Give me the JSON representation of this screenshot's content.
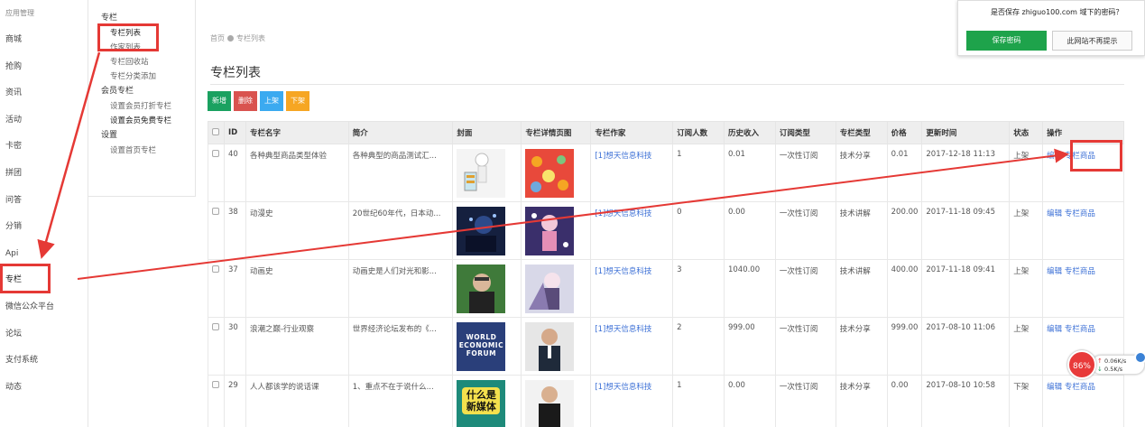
{
  "leftnav": {
    "header": "应用管理",
    "items": [
      "商城",
      "抢购",
      "资讯",
      "活动",
      "卡密",
      "拼团",
      "问答",
      "分销",
      "Api",
      "专栏",
      "微信公众平台",
      "论坛",
      "支付系统",
      "动态"
    ]
  },
  "subnav": {
    "group1": "专栏",
    "g1_items": [
      "专栏列表",
      "作家列表",
      "专栏回收站",
      "专栏分类添加"
    ],
    "group2": "会员专栏",
    "g2_items": [
      "设置会员打折专栏",
      "设置会员免费专栏"
    ],
    "group3": "设置",
    "g3_items": [
      "设置首页专栏"
    ]
  },
  "breadcrumb": {
    "home": "首页",
    "current": "专栏列表"
  },
  "page_title": "专栏列表",
  "toolbar": {
    "add": "新增",
    "delete": "删除",
    "publish": "上架",
    "unpublish": "下架"
  },
  "table": {
    "headers": [
      "ID",
      "专栏名字",
      "简介",
      "封面",
      "专栏详情页图",
      "专栏作家",
      "订阅人数",
      "历史收入",
      "订阅类型",
      "专栏类型",
      "价格",
      "更新时间",
      "状态",
      "操作"
    ],
    "rows": [
      {
        "id": "40",
        "name": "各种典型商品类型体验",
        "intro": "各种典型的商品测试汇...",
        "author": "[1]想天信息科技",
        "subs": "1",
        "income": "0.01",
        "sub_type": "一次性订阅",
        "col_type": "技术分享",
        "price": "0.01",
        "updated": "2017-12-18 11:13",
        "status": "上架"
      },
      {
        "id": "38",
        "name": "动漫史",
        "intro": "20世纪60年代，日本动...",
        "author": "[1]想天信息科技",
        "subs": "0",
        "income": "0.00",
        "sub_type": "一次性订阅",
        "col_type": "技术讲解",
        "price": "200.00",
        "updated": "2017-11-18 09:45",
        "status": "上架"
      },
      {
        "id": "37",
        "name": "动画史",
        "intro": "动画史是人们对光和影...",
        "author": "[1]想天信息科技",
        "subs": "3",
        "income": "1040.00",
        "sub_type": "一次性订阅",
        "col_type": "技术讲解",
        "price": "400.00",
        "updated": "2017-11-18 09:41",
        "status": "上架"
      },
      {
        "id": "30",
        "name": "浪潮之巅-行业观察",
        "intro": "世界经济论坛发布的《...",
        "author": "[1]想天信息科技",
        "subs": "2",
        "income": "999.00",
        "sub_type": "一次性订阅",
        "col_type": "技术分享",
        "price": "999.00",
        "updated": "2017-08-10 11:06",
        "status": "上架"
      },
      {
        "id": "29",
        "name": "人人都该学的说话课",
        "intro": "1、重点不在于说什么...",
        "author": "[1]想天信息科技",
        "subs": "1",
        "income": "0.00",
        "sub_type": "一次性订阅",
        "col_type": "技术分享",
        "price": "0.00",
        "updated": "2017-08-10 10:58",
        "status": "下架"
      }
    ],
    "action_edit": "编辑",
    "action_goods": "专栏商品"
  },
  "cover_texts": {
    "world_economic_forum": "WORLD ECONOMIC FORUM",
    "new_media": "什么是新媒体"
  },
  "password_prompt": {
    "question": "是否保存 zhiguo100.com 域下的密码？",
    "save": "保存密码",
    "never": "此网站不再提示"
  },
  "speed_widget": {
    "percent": "86%",
    "up": "0.06K/s",
    "down": "0.5K/s"
  },
  "colors": {
    "annotation": "#e53935",
    "link": "#3b6fd6",
    "save_green": "#1ea34b"
  }
}
